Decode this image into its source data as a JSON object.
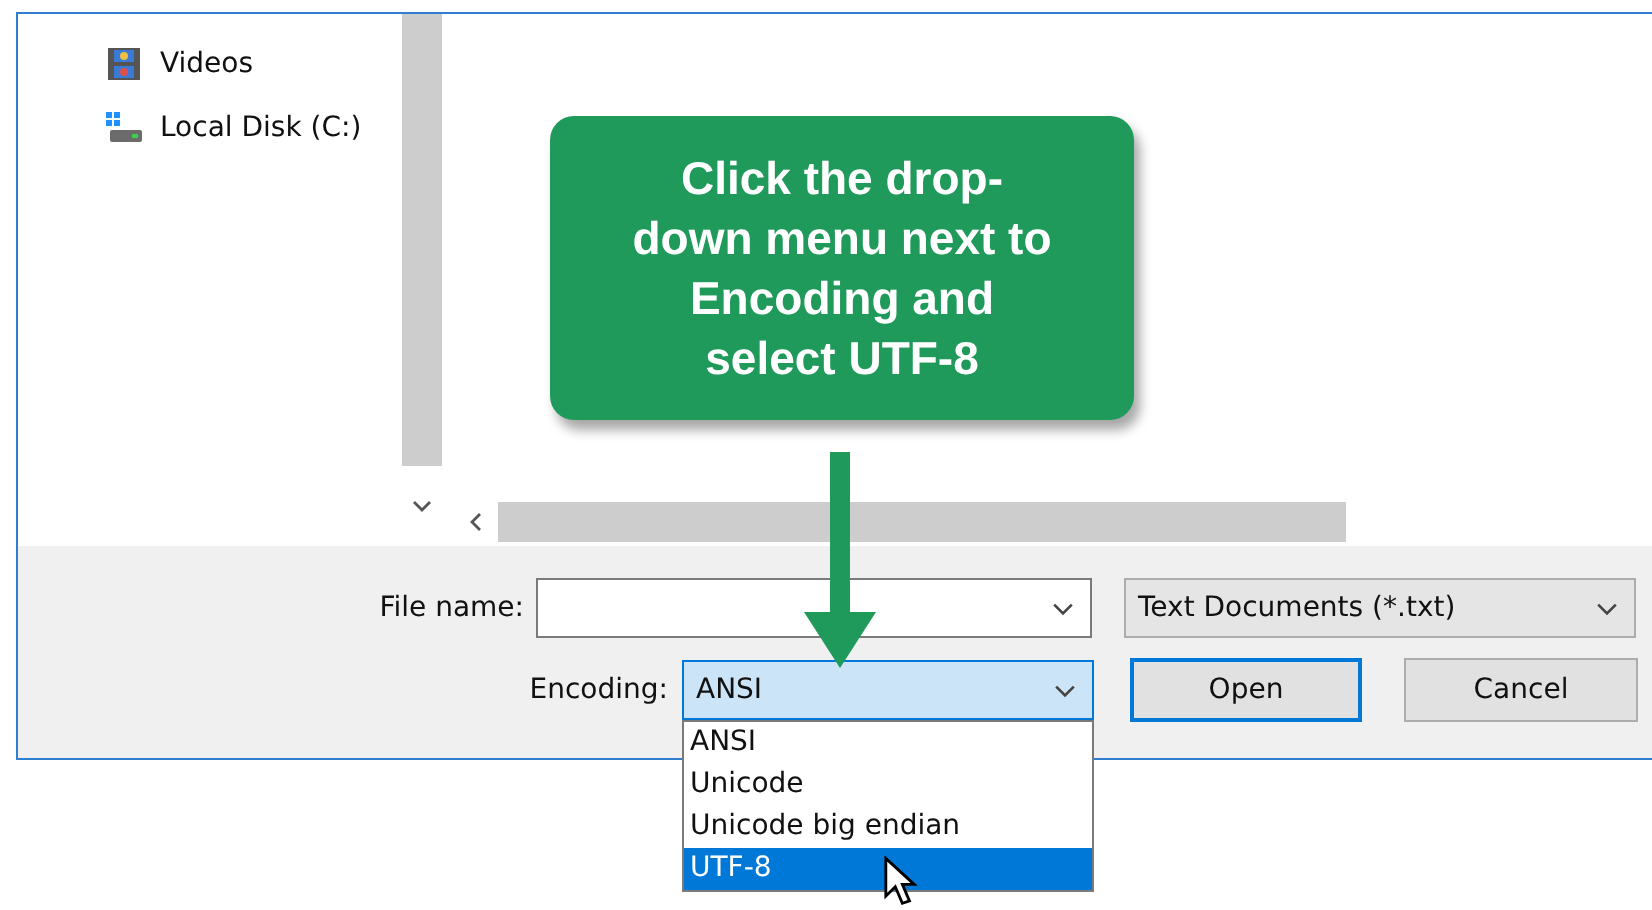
{
  "nav_items": [
    {
      "label": "Videos",
      "kind": "video"
    },
    {
      "label": "Local Disk (C:)",
      "kind": "disk"
    }
  ],
  "callout": {
    "text": "Click the drop-down menu next to Encoding and select UTF-8"
  },
  "file_name": {
    "label": "File name:"
  },
  "file_type": {
    "value": "Text Documents (*.txt)"
  },
  "encoding": {
    "label": "Encoding:",
    "value": "ANSI",
    "expanded": true,
    "options": [
      {
        "label": "ANSI",
        "highlighted": false
      },
      {
        "label": "Unicode",
        "highlighted": false
      },
      {
        "label": "Unicode big endian",
        "highlighted": false
      },
      {
        "label": "UTF-8",
        "highlighted": true
      }
    ]
  },
  "buttons": [
    {
      "label": "Open",
      "default": true
    },
    {
      "label": "Cancel",
      "default": false
    }
  ]
}
